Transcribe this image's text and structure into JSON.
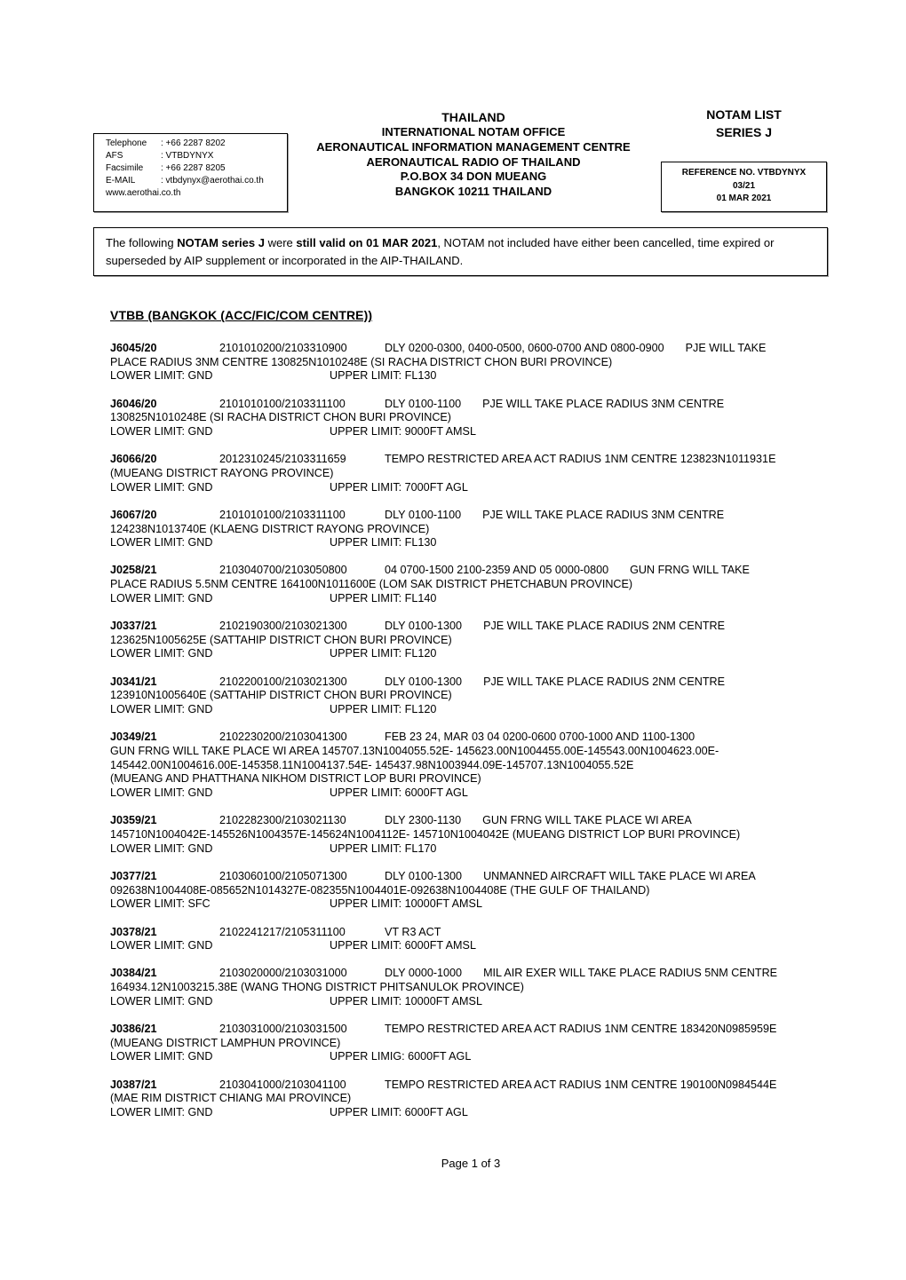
{
  "contact": {
    "rows": [
      {
        "label": "Telephone",
        "value": ": +66 2287 8202"
      },
      {
        "label": "AFS",
        "value": ": VTBDYNYX"
      },
      {
        "label": "Facsimile",
        "value": ": +66 2287 8205"
      },
      {
        "label": "E-MAIL",
        "value": ": vtbdynyx@aerothai.co.th"
      }
    ],
    "website": "www.aerothai.co.th"
  },
  "header": {
    "country": "THAILAND",
    "lines": [
      "INTERNATIONAL NOTAM OFFICE",
      "AERONAUTICAL INFORMATION MANAGEMENT CENTRE",
      "AERONAUTICAL RADIO OF THAILAND",
      "P.O.BOX 34 DON MUEANG",
      "BANGKOK 10211 THAILAND"
    ]
  },
  "list_title": {
    "line1": "NOTAM LIST",
    "line2": "SERIES J"
  },
  "reference": {
    "number": "REFERENCE NO. VTBDYNYX",
    "issue": "03/21",
    "date": "01 MAR 2021"
  },
  "notice": {
    "part1": "The following ",
    "bold1": "NOTAM series J",
    "part2": " were ",
    "bold2": "still valid on 01 MAR 2021",
    "part3": ", NOTAM not included have either been cancelled, time expired or superseded by AIP supplement or incorporated in the AIP-THAILAND."
  },
  "section_heading": "VTBB (BANGKOK (ACC/FIC/COM CENTRE))",
  "notams": [
    {
      "id": "J6045/20",
      "period": "2101010200/2103310900",
      "schedule": "DLY 0200-0300, 0400-0500, 0600-0700 AND 0800-0900",
      "text_first": "PJE WILL TAKE",
      "text_lines": [
        "PLACE RADIUS 3NM CENTRE 130825N1010248E (SI RACHA DISTRICT CHON BURI PROVINCE)"
      ],
      "lower": "LOWER LIMIT: GND",
      "upper": "UPPER LIMIT: FL130"
    },
    {
      "id": "J6046/20",
      "period": "2101010100/2103311100",
      "schedule": "DLY 0100-1100",
      "text_first": "PJE WILL TAKE PLACE RADIUS 3NM CENTRE",
      "text_lines": [
        "130825N1010248E (SI RACHA DISTRICT CHON BURI PROVINCE)"
      ],
      "lower": "LOWER LIMIT: GND",
      "upper": "UPPER LIMIT: 9000FT AMSL"
    },
    {
      "id": "J6066/20",
      "period": "2012310245/2103311659",
      "schedule": "TEMPO RESTRICTED AREA ACT RADIUS 1NM CENTRE 123823N1011931E",
      "text_first": "",
      "text_lines": [
        "(MUEANG DISTRICT RAYONG PROVINCE)"
      ],
      "lower": "LOWER LIMIT: GND",
      "upper": "UPPER LIMIT: 7000FT AGL"
    },
    {
      "id": "J6067/20",
      "period": "2101010100/2103311100",
      "schedule": "DLY 0100-1100",
      "text_first": "PJE WILL TAKE PLACE RADIUS 3NM CENTRE",
      "text_lines": [
        "124238N1013740E (KLAENG DISTRICT RAYONG PROVINCE)"
      ],
      "lower": "LOWER LIMIT: GND",
      "upper": "UPPER LIMIT: FL130"
    },
    {
      "id": "J0258/21",
      "period": "2103040700/2103050800",
      "schedule": "04 0700-1500 2100-2359 AND 05 0000-0800",
      "text_first": "GUN FRNG WILL TAKE",
      "text_lines": [
        "PLACE RADIUS 5.5NM CENTRE 164100N1011600E (LOM SAK DISTRICT PHETCHABUN PROVINCE)"
      ],
      "lower": "LOWER LIMIT: GND",
      "upper": "UPPER LIMIT: FL140"
    },
    {
      "id": "J0337/21",
      "period": "2102190300/2103021300",
      "schedule": "DLY 0100-1300",
      "text_first": "PJE WILL TAKE PLACE RADIUS 2NM CENTRE",
      "text_lines": [
        "123625N1005625E (SATTAHIP DISTRICT CHON BURI PROVINCE)"
      ],
      "lower": "LOWER LIMIT: GND",
      "upper": "UPPER LIMIT: FL120"
    },
    {
      "id": "J0341/21",
      "period": "2102200100/2103021300",
      "schedule": "DLY 0100-1300",
      "text_first": "PJE WILL TAKE PLACE RADIUS 2NM CENTRE",
      "text_lines": [
        "123910N1005640E (SATTAHIP DISTRICT CHON BURI PROVINCE)"
      ],
      "lower": "LOWER LIMIT: GND",
      "upper": "UPPER LIMIT: FL120"
    },
    {
      "id": "J0349/21",
      "period": "2102230200/2103041300",
      "schedule": "FEB 23 24, MAR 03 04 0200-0600 0700-1000 AND 1100-1300",
      "text_first": "",
      "text_lines": [
        "GUN FRNG WILL TAKE PLACE WI AREA 145707.13N1004055.52E- 145623.00N1004455.00E-145543.00N1004623.00E-",
        "145442.00N1004616.00E-145358.11N1004137.54E- 145437.98N1003944.09E-145707.13N1004055.52E",
        "(MUEANG AND PHATTHANA NIKHOM DISTRICT LOP BURI PROVINCE)"
      ],
      "lower": "LOWER LIMIT: GND",
      "upper": "UPPER LIMIT: 6000FT AGL"
    },
    {
      "id": "J0359/21",
      "period": "2102282300/2103021130",
      "schedule": "DLY 2300-1130",
      "text_first": "GUN FRNG WILL TAKE PLACE WI AREA",
      "text_lines": [
        "145710N1004042E-145526N1004357E-145624N1004112E- 145710N1004042E (MUEANG DISTRICT LOP BURI PROVINCE)"
      ],
      "lower": "LOWER LIMIT: GND",
      "upper": "UPPER LIMIT: FL170"
    },
    {
      "id": "J0377/21",
      "period": "2103060100/2105071300",
      "schedule": "DLY 0100-1300",
      "text_first": "UNMANNED AIRCRAFT WILL TAKE PLACE WI AREA",
      "text_lines": [
        "092638N1004408E-085652N1014327E-082355N1004401E-092638N1004408E (THE GULF OF THAILAND)"
      ],
      "lower": "LOWER LIMIT: SFC",
      "upper": "UPPER LIMIT: 10000FT AMSL"
    },
    {
      "id": "J0378/21",
      "period": "2102241217/2105311100",
      "schedule": "VT R3 ACT",
      "text_first": "",
      "text_lines": [],
      "lower": "LOWER LIMIT: GND",
      "upper": "UPPER LIMIT: 6000FT AMSL"
    },
    {
      "id": "J0384/21",
      "period": "2103020000/2103031000",
      "schedule": "DLY 0000-1000",
      "text_first": "MIL AIR EXER WILL TAKE PLACE RADIUS 5NM CENTRE",
      "text_lines": [
        "164934.12N1003215.38E (WANG THONG DISTRICT PHITSANULOK PROVINCE)"
      ],
      "lower": "LOWER LIMIT: GND",
      "upper": "UPPER LIMIT: 10000FT AMSL"
    },
    {
      "id": "J0386/21",
      "period": "2103031000/2103031500",
      "schedule": "TEMPO RESTRICTED AREA ACT RADIUS 1NM CENTRE 183420N0985959E",
      "text_first": "",
      "text_lines": [
        "(MUEANG DISTRICT LAMPHUN PROVINCE)"
      ],
      "lower": "LOWER LIMIT: GND",
      "upper": "UPPER LIMIG: 6000FT AGL"
    },
    {
      "id": "J0387/21",
      "period": "2103041000/2103041100",
      "schedule": "TEMPO RESTRICTED AREA ACT RADIUS 1NM CENTRE 190100N0984544E",
      "text_first": "",
      "text_lines": [
        "(MAE RIM DISTRICT CHIANG MAI PROVINCE)"
      ],
      "lower": "LOWER LIMIT: GND",
      "upper": "UPPER LIMIT: 6000FT AGL"
    }
  ],
  "footer": {
    "page_label": "Page 1 of 3"
  }
}
